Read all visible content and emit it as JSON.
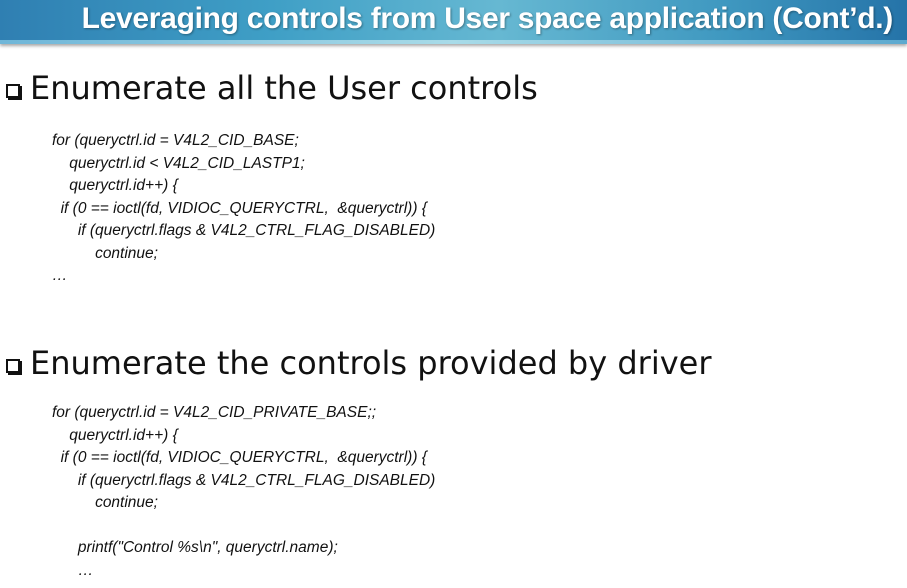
{
  "slide": {
    "title": "Leveraging controls from User space application (Cont’d.)"
  },
  "sections": [
    {
      "bullet_icon": "hollow-square-bullet-icon",
      "heading": "Enumerate all the User controls",
      "code_lines": [
        "for (queryctrl.id = V4L2_CID_BASE;",
        "    queryctrl.id < V4L2_CID_LASTP1;",
        "    queryctrl.id++) {",
        "  if (0 == ioctl(fd, VIDIOC_QUERYCTRL,  &queryctrl)) {",
        "      if (queryctrl.flags & V4L2_CTRL_FLAG_DISABLED)",
        "          continue;",
        "…"
      ]
    },
    {
      "bullet_icon": "hollow-square-bullet-icon",
      "heading": "Enumerate the controls provided by driver",
      "code_lines": [
        "for (queryctrl.id = V4L2_CID_PRIVATE_BASE;;",
        "    queryctrl.id++) {",
        "  if (0 == ioctl(fd, VIDIOC_QUERYCTRL,  &queryctrl)) {",
        "      if (queryctrl.flags & V4L2_CTRL_FLAG_DISABLED)",
        "          continue;",
        "",
        "      printf(\"Control %s\\n\", queryctrl.name);",
        "      …"
      ]
    }
  ]
}
